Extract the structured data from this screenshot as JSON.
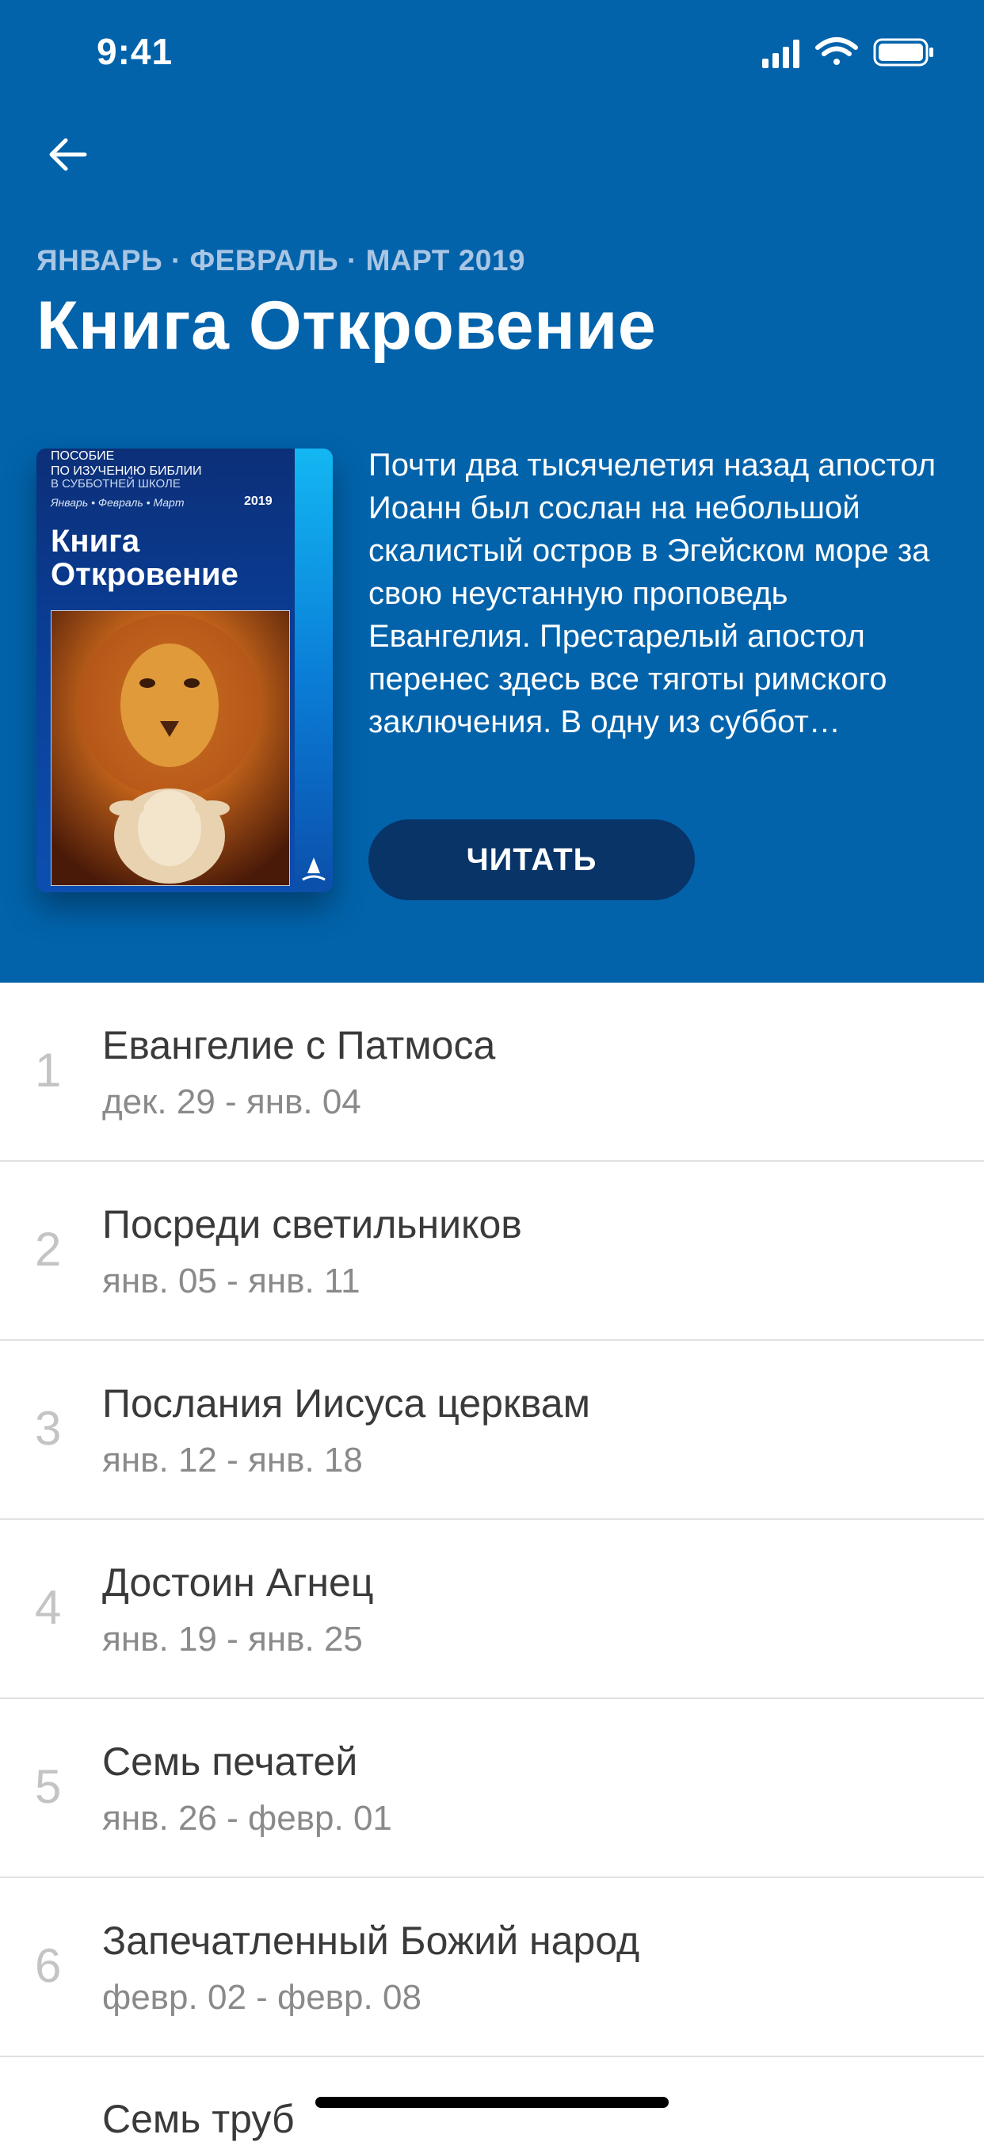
{
  "status_bar": {
    "time": "9:41"
  },
  "header": {
    "quarter": "ЯНВАРЬ · ФЕВРАЛЬ · МАРТ 2019",
    "title": "Книга Откровение",
    "description": "Почти два тысячелетия назад апостол Иоанн был сослан на небольшой скалистый остров в Эгейском море за свою неустанную проповедь Евангелия. Престарелый апостол перенес здесь все тяготы римского заключения. В одну из суббот…",
    "read_button": "ЧИТАТЬ"
  },
  "cover": {
    "line1": "ПОСОБИЕ",
    "line2": "ПО ИЗУЧЕНИЮ БИБЛИИ",
    "line3": "В СУББОТНЕЙ ШКОЛЕ",
    "months": "Январь • Февраль • Март",
    "year": "2019",
    "title": "Книга Откровение"
  },
  "lessons": [
    {
      "num": "1",
      "title": "Евангелие с Патмоса",
      "date": "дек. 29 - янв. 04"
    },
    {
      "num": "2",
      "title": "Посреди светильников",
      "date": "янв. 05 - янв. 11"
    },
    {
      "num": "3",
      "title": "Послания Иисуса церквам",
      "date": "янв. 12 - янв. 18"
    },
    {
      "num": "4",
      "title": "Достоин Агнец",
      "date": "янв. 19 - янв. 25"
    },
    {
      "num": "5",
      "title": "Семь печатей",
      "date": "янв. 26 - февр. 01"
    },
    {
      "num": "6",
      "title": "Запечатленный Божий народ",
      "date": "февр. 02 - февр. 08"
    }
  ],
  "partial_lesson": {
    "title": "Семь труб"
  },
  "colors": {
    "header_bg": "#0263ab",
    "button_bg": "#083468"
  }
}
